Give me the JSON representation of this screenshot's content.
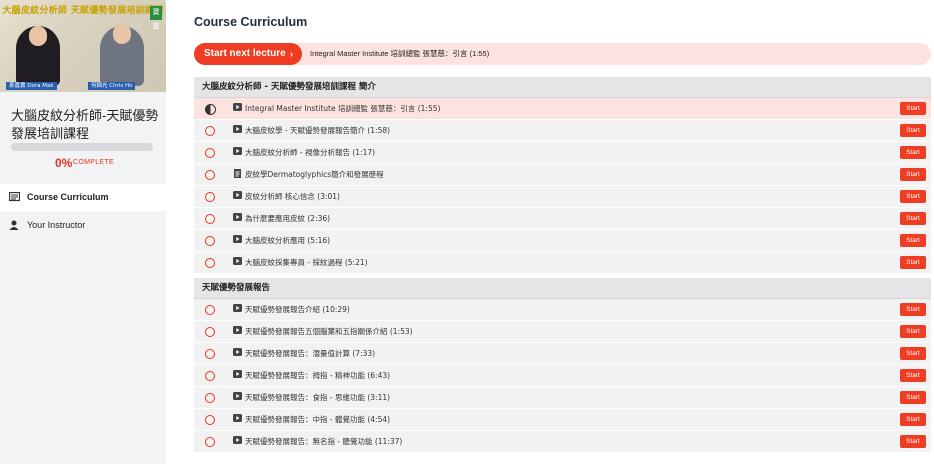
{
  "sidebar": {
    "thumbnail": {
      "title": "大腦皮紋分析師 天賦優勢發展培訓課程",
      "badge": "寶盛",
      "host1": "麥嘉寶 Dora Mak",
      "host2": "何錦光 Chris Ho"
    },
    "course_title": "大腦皮紋分析師-天賦優勢發展培訓課程",
    "progress": {
      "percent": "0%",
      "complete_label": "COMPLETE",
      "fraction": 0
    },
    "nav": [
      {
        "label": "Course Curriculum",
        "icon": "curriculum-icon"
      },
      {
        "label": "Your Instructor",
        "icon": "user-icon"
      }
    ]
  },
  "main": {
    "title": "Course Curriculum",
    "next_lecture": {
      "button_label": "Start next lecture",
      "arrow": "›",
      "lecture_title": "Integral Master Institute 培訓總監 張慧慈：引言 (1:55)"
    },
    "start_label": "Start",
    "sections": [
      {
        "title": "大腦皮紋分析師 - 天賦優勢發展培訓課程 簡介",
        "lectures": [
          {
            "title": "Integral Master Institute 培訓總監 張慧慈：引言 (1:55)",
            "type": "video",
            "status": "current"
          },
          {
            "title": "大腦皮紋學 - 天賦優勢發展報告簡介 (1:58)",
            "type": "video",
            "status": "incomplete"
          },
          {
            "title": "大腦皮紋分析師 - 視像分析報告 (1:17)",
            "type": "video",
            "status": "incomplete"
          },
          {
            "title": "皮紋學Dermatoglyphics簡介和發展歷程",
            "type": "document",
            "status": "incomplete"
          },
          {
            "title": "皮紋分析師 核心信念 (3:01)",
            "type": "video",
            "status": "incomplete"
          },
          {
            "title": "為什麼要應用皮紋 (2:36)",
            "type": "video",
            "status": "incomplete"
          },
          {
            "title": "大腦皮紋分析應用 (5:16)",
            "type": "video",
            "status": "incomplete"
          },
          {
            "title": "大腦皮紋採集專員 - 採紋過程 (5:21)",
            "type": "video",
            "status": "incomplete"
          }
        ]
      },
      {
        "title": "天賦優勢發展報告",
        "lectures": [
          {
            "title": "天賦優勢發展報告介紹 (10:29)",
            "type": "video",
            "status": "incomplete"
          },
          {
            "title": "天賦優勢發展報告五個腦葉和五指關係介紹 (1:53)",
            "type": "video",
            "status": "incomplete"
          },
          {
            "title": "天賦優勢發展報告：潛量值計算 (7:33)",
            "type": "video",
            "status": "incomplete"
          },
          {
            "title": "天賦優勢發展報告：拇指 - 精神功能 (6:43)",
            "type": "video",
            "status": "incomplete"
          },
          {
            "title": "天賦優勢發展報告：食指 - 思維功能 (3:11)",
            "type": "video",
            "status": "incomplete"
          },
          {
            "title": "天賦優勢發展報告：中指 - 體覺功能 (4:54)",
            "type": "video",
            "status": "incomplete"
          },
          {
            "title": "天賦優勢發展報告：無名指 - 聽覺功能 (11:37)",
            "type": "video",
            "status": "incomplete"
          }
        ]
      }
    ]
  },
  "colors": {
    "accent": "#ee3d22",
    "highlight": "#fde3e0",
    "row": "#f2f2f3",
    "section": "#e4e5e7",
    "sidebar": "#f2f3f5"
  }
}
